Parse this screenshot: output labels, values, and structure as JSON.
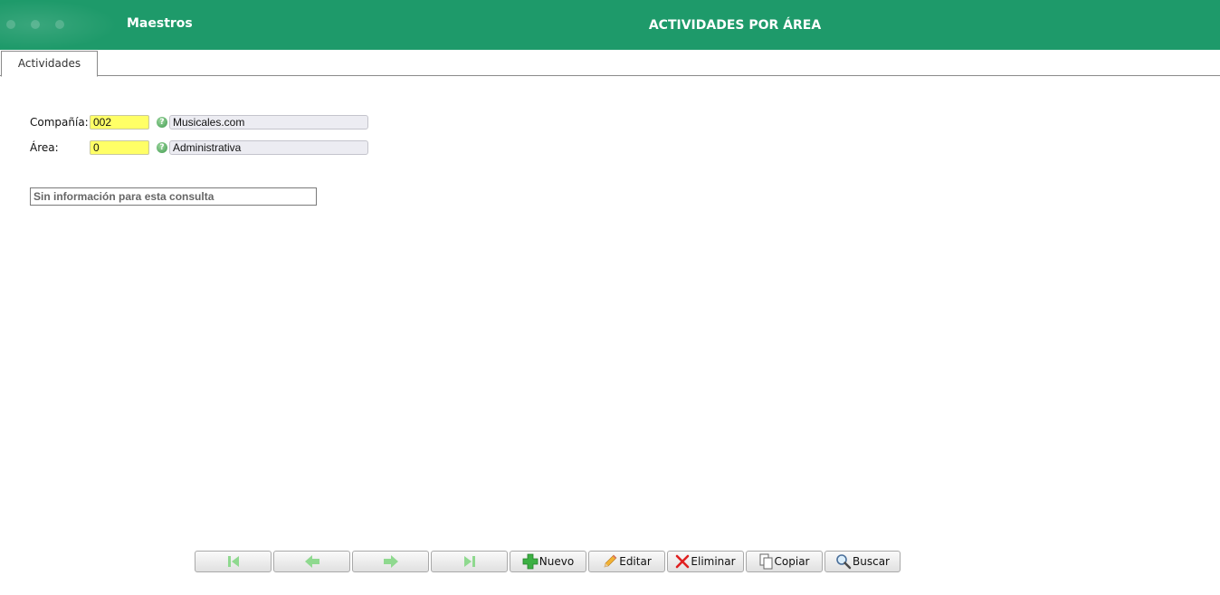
{
  "header": {
    "module_title": "Maestros",
    "page_title": "ACTIVIDADES POR ÁREA",
    "color": "#1e9a6a"
  },
  "tabs": [
    {
      "label": "Actividades",
      "active": true
    }
  ],
  "form": {
    "company": {
      "label": "Compañía:",
      "code": "002",
      "description": "Musicales.com"
    },
    "area": {
      "label": "Área:",
      "code": "0",
      "description": "Administrativa"
    },
    "help_icon_glyph": "?"
  },
  "message": "Sin información para esta consulta",
  "toolbar": {
    "nav": [
      {
        "name": "first",
        "icon": "first-page-icon",
        "enabled": false
      },
      {
        "name": "previous",
        "icon": "arrow-left-icon",
        "enabled": false
      },
      {
        "name": "next",
        "icon": "arrow-right-icon",
        "enabled": false
      },
      {
        "name": "last",
        "icon": "last-page-icon",
        "enabled": false
      }
    ],
    "nuevo_label": "Nuevo",
    "editar_label": "Editar",
    "eliminar_label": "Eliminar",
    "copiar_label": "Copiar",
    "buscar_label": "Buscar"
  }
}
